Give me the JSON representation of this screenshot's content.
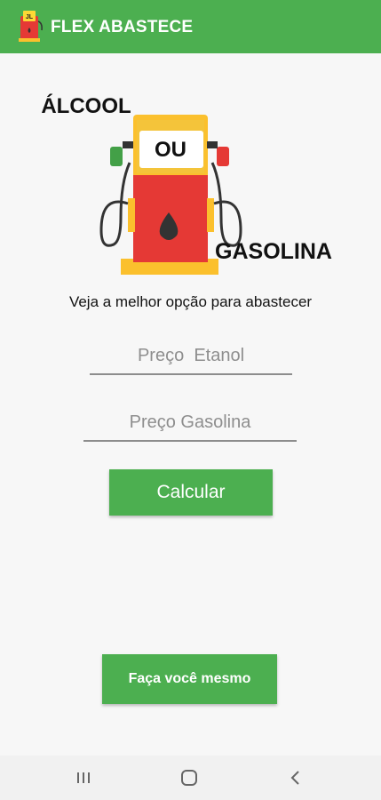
{
  "app": {
    "title": "FLEX ABASTECE",
    "accent": "#4caf50"
  },
  "logo": {
    "word_top": "ÁLCOOL",
    "word_middle": "OU",
    "word_bottom": "GASOLINA",
    "icon_badge": "JL"
  },
  "subtitle": "Veja a melhor opção para abastecer",
  "inputs": {
    "etanol_placeholder": "Preço  Etanol",
    "etanol_value": "",
    "gasolina_placeholder": "Preço Gasolina",
    "gasolina_value": ""
  },
  "buttons": {
    "calcular": "Calcular",
    "faca_voce_mesmo": "Faça você mesmo"
  },
  "navbar": {
    "icons": [
      "recent-apps-icon",
      "home-icon",
      "back-icon"
    ]
  }
}
